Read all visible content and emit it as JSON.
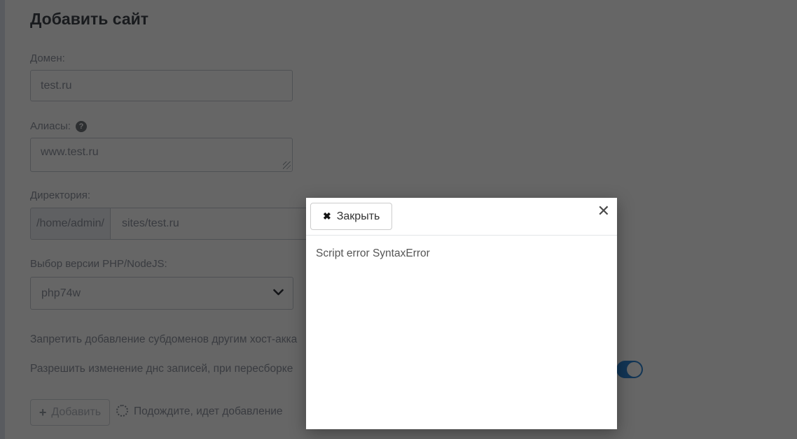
{
  "page": {
    "title": "Добавить сайт"
  },
  "form": {
    "domain": {
      "label": "Домен:",
      "value": "test.ru"
    },
    "aliases": {
      "label": "Алиасы:",
      "value": "www.test.ru",
      "help_icon": "?"
    },
    "directory": {
      "label": "Директория:",
      "prefix": "/home/admin/",
      "value": "sites/test.ru"
    },
    "php": {
      "label": "Выбор версии PHP/NodeJS:",
      "selected": "php74w"
    },
    "options": [
      {
        "label": "Запретить добавление субдоменов другим хост-акка"
      },
      {
        "label": "Разрешить изменение днс записей, при пересборке",
        "toggle_state": "on"
      }
    ],
    "submit": {
      "label": "Добавить",
      "plus_icon": "+",
      "disabled": true
    },
    "progress": {
      "label": "Подождите, идет добавление"
    }
  },
  "modal": {
    "close_button": {
      "label": "Закрыть",
      "icon": "✖"
    },
    "corner_close_icon": "✕",
    "body_text": "Script error SyntaxError"
  },
  "colors": {
    "toggle_on": "#2f86d4",
    "overlay": "rgba(0,0,0,0.6)",
    "accent_text": "#8f95a0"
  }
}
